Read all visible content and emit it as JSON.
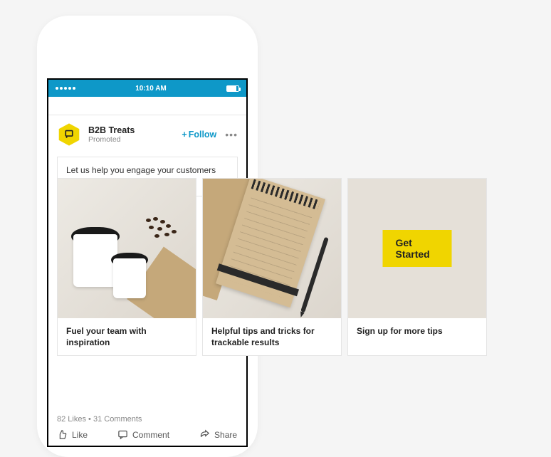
{
  "status": {
    "time": "10:10 AM"
  },
  "post": {
    "advertiser": "B2B Treats",
    "tag": "Promoted",
    "follow": "Follow",
    "text": "Let us help you engage your customers with delicious content."
  },
  "cards": [
    {
      "caption": "Fuel your team with inspiration"
    },
    {
      "caption": "Helpful tips and tricks for trackable results"
    },
    {
      "caption": "Sign up for more tips",
      "cta": "Get Started"
    }
  ],
  "engagement": {
    "likes": "82 Likes",
    "comments": "31 Comments",
    "separator": " • "
  },
  "actions": {
    "like": "Like",
    "comment": "Comment",
    "share": "Share"
  }
}
